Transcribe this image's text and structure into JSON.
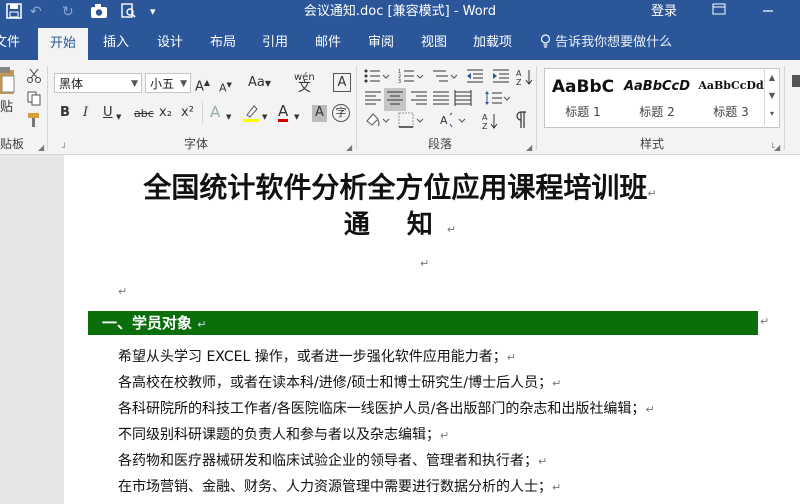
{
  "titlebar": {
    "document_title": "会议通知.doc [兼容模式]  -  Word",
    "login": "登录",
    "bg_color": "#2b579a"
  },
  "quick_access": {
    "undo": "↶",
    "redo": "↻",
    "dropdown": "▾"
  },
  "ribbon_tabs": [
    {
      "label": "文件"
    },
    {
      "label": "开始"
    },
    {
      "label": "插入"
    },
    {
      "label": "设计"
    },
    {
      "label": "布局"
    },
    {
      "label": "引用"
    },
    {
      "label": "邮件"
    },
    {
      "label": "审阅"
    },
    {
      "label": "视图"
    },
    {
      "label": "加载项"
    }
  ],
  "tell_me": "告诉我你想要做什么",
  "font": {
    "family": "黑体",
    "size": "小五",
    "grow_shrink": "Aa",
    "wen": "wén",
    "wen_char": "文",
    "box_char": "A",
    "bold": "B",
    "italic": "I",
    "underline": "U",
    "strike": "abc",
    "sub": "x₂",
    "sup": "x²",
    "effects": "A",
    "font_color": "A",
    "char_shade": "A",
    "enclose": "字"
  },
  "styles": [
    {
      "preview": "AaBbC",
      "name": "标题 1"
    },
    {
      "preview": "AaBbCcD",
      "name": "标题 2"
    },
    {
      "preview": "AaBbCcDd",
      "name": "标题 3"
    }
  ],
  "groups": {
    "clipboard": "贴板",
    "paste": "贴",
    "font": "字体",
    "paragraph": "段落",
    "styles": "样式"
  },
  "document": {
    "title": "全国统计软件分析全方位应用课程培训班",
    "subtitle": "通 知",
    "return_mark": "↵",
    "section_heading": "一、学员对象",
    "lines": [
      "希望从头学习 EXCEL 操作，或者进一步强化软件应用能力者；",
      "各高校在校教师，或者在读本科/进修/硕士和博士研究生/博士后人员；",
      "各科研院所的科技工作者/各医院临床一线医护人员/各出版部门的杂志和出版社编辑；",
      "不同级别科研课题的负责人和参与者以及杂志编辑；",
      "各药物和医疗器械研发和临床试验企业的领导者、管理者和执行者；",
      "在市场营销、金融、财务、人力资源管理中需要进行数据分析的人士；"
    ],
    "section_color": "#0a6e0a"
  }
}
